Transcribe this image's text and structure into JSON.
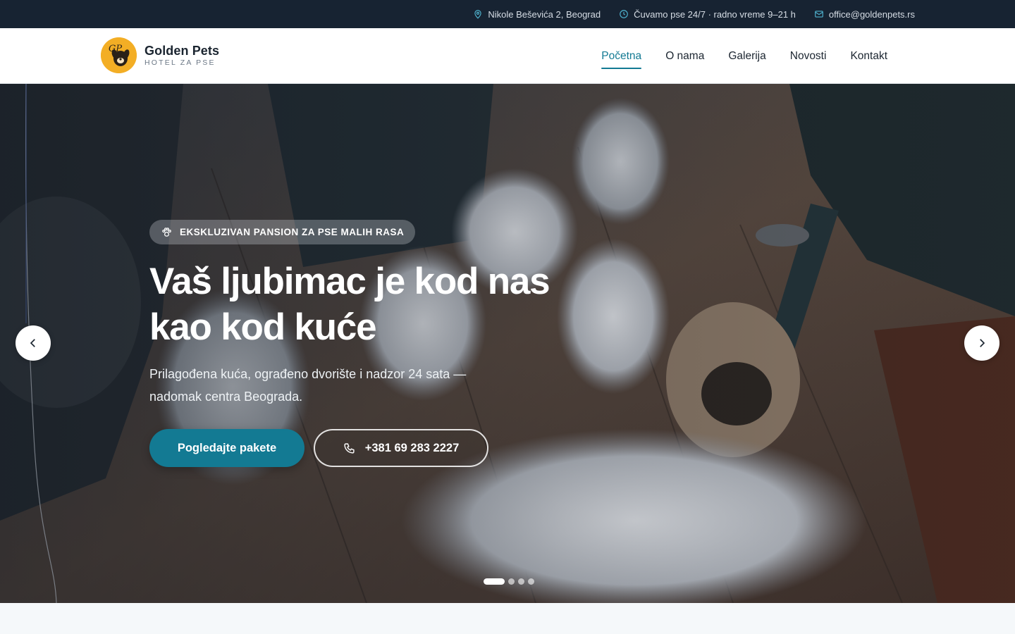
{
  "topbar": {
    "address": "Nikole Beševića 2, Beograd",
    "hours": "Čuvamo pse 24/7 · radno vreme 9–21 h",
    "email": "office@goldenpets.rs",
    "icons": [
      "map-pin-icon",
      "clock-icon",
      "mail-icon"
    ]
  },
  "brand": {
    "name": "Golden Pets",
    "tagline": "HOTEL ZA PSE",
    "logo_color": "#f3ae25"
  },
  "nav": {
    "items": [
      {
        "label": "Početna",
        "active": true
      },
      {
        "label": "O nama",
        "active": false
      },
      {
        "label": "Galerija",
        "active": false
      },
      {
        "label": "Novosti",
        "active": false
      },
      {
        "label": "Kontakt",
        "active": false
      }
    ]
  },
  "hero": {
    "badge": "EKSKLUZIVAN PANSION ZA PSE MALIH RASA",
    "title": "Vaš ljubimac je kod nas kao kod kuće",
    "subtitle": "Prilagođena kuća, ograđeno dvorište i nadzor 24 sata — nadomak centra Beograda.",
    "primary_button": "Pogledajte pakete",
    "phone_button": "+381 69 283 2227",
    "slides_total": 4,
    "active_slide": 1
  },
  "colors": {
    "accent": "#137a93",
    "topbar_bg": "#172332",
    "header_bg": "#ffffff"
  }
}
